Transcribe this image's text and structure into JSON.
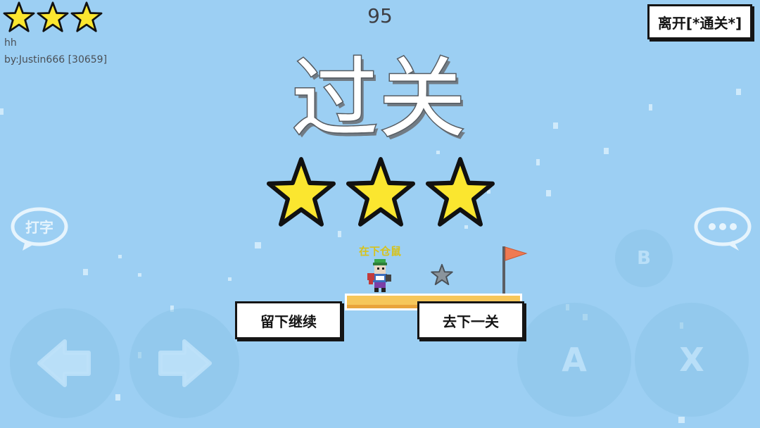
{
  "hud": {
    "rating_stars": 3,
    "score": "95",
    "level_name": "hh",
    "level_author": "by:Justin666 [30659]",
    "leave_button": "离开[*通关*]"
  },
  "result": {
    "title": "过关",
    "stars_earned": 3,
    "player_name": "在下仓鼠",
    "stay_button": "留下继续",
    "next_button": "去下一关"
  },
  "controls": {
    "type_label": "打字",
    "chat_label": "...",
    "b_label": "B",
    "a_label": "A",
    "x_label": "X"
  },
  "colors": {
    "background": "#9ccff3",
    "star_fill": "#fbe62f",
    "flag": "#ef7a52",
    "platform": "#f6c75b"
  }
}
